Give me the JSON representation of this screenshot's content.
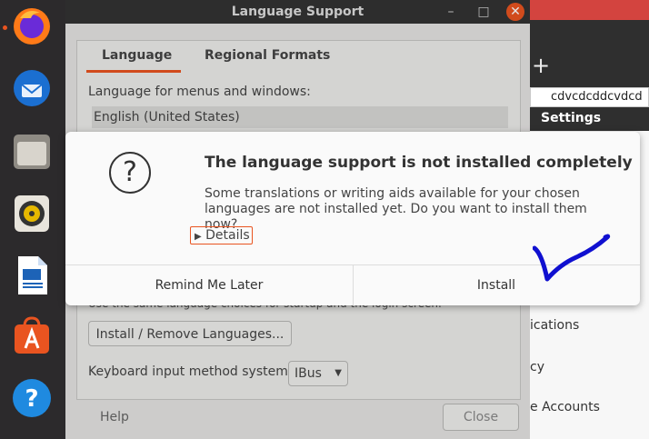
{
  "window": {
    "title": "Language Support",
    "tabs": [
      "Language",
      "Regional Formats"
    ],
    "language_label": "Language for menus and windows:",
    "language_item": "English (United States)",
    "clipped_text": "Use the same language choices for startup and the login screen.",
    "install_remove_button": "Install / Remove Languages...",
    "keyboard_label": "Keyboard input method system:",
    "keyboard_value": "IBus",
    "help_button": "Help",
    "close_button": "Close",
    "controls": {
      "minimize": "–",
      "maximize": "□",
      "close": "✕"
    }
  },
  "dialog": {
    "title": "The language support is not installed completely",
    "body": "Some translations or writing aids available for your chosen languages are not installed yet. Do you want to install them now?",
    "details": "Details",
    "remind_button": "Remind Me Later",
    "install_button": "Install"
  },
  "background_settings": {
    "plus": "+",
    "search_text": "cdvcdcddcvdcd",
    "title": "Settings",
    "list": [
      "ications",
      "cy",
      "e Accounts"
    ]
  },
  "dock": {
    "items": [
      "firefox-icon",
      "thunderbird-icon",
      "files-icon",
      "rhythmbox-icon",
      "libreoffice-writer-icon",
      "software-icon",
      "help-icon"
    ]
  },
  "colors": {
    "accent": "#e95420",
    "annotation": "#1010d0"
  }
}
